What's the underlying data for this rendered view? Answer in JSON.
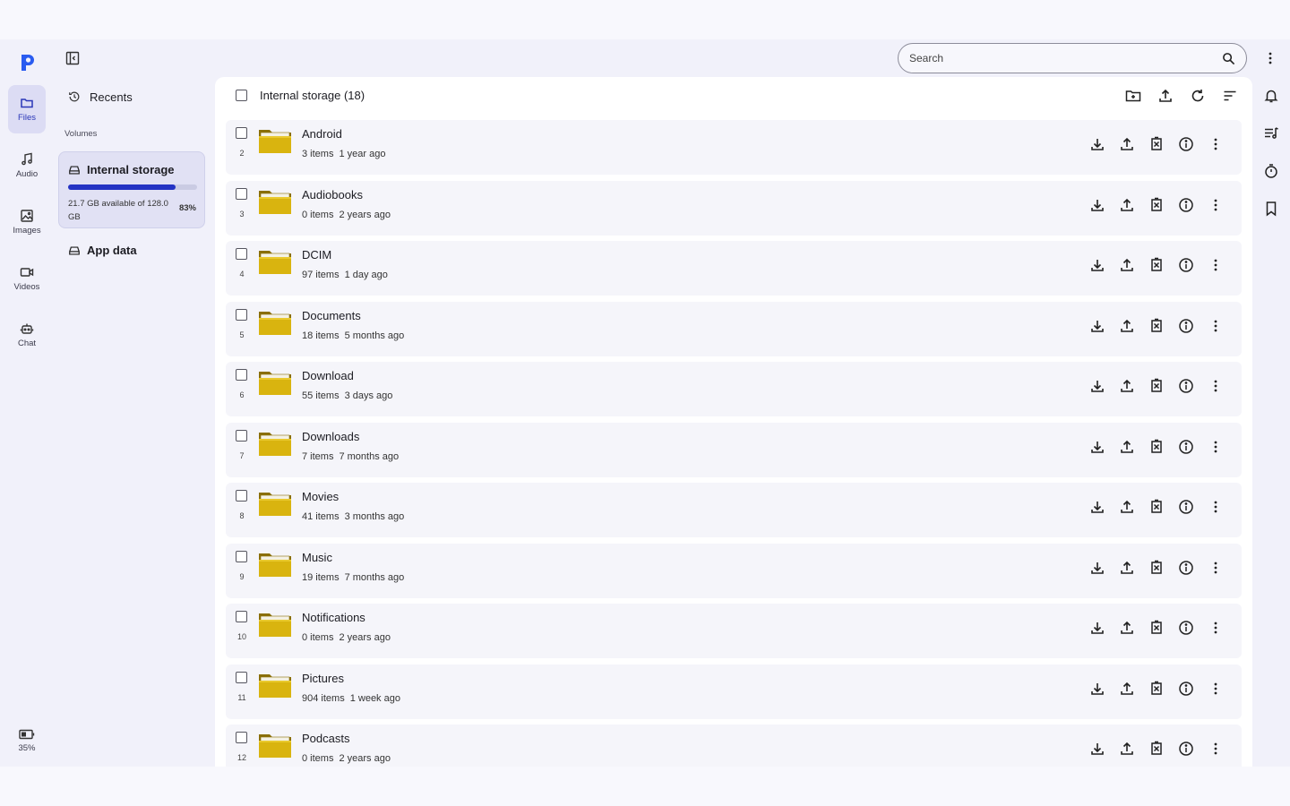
{
  "nav": {
    "items": [
      {
        "label": "Files",
        "icon": "folder-icon",
        "active": true
      },
      {
        "label": "Audio",
        "icon": "music-note-icon"
      },
      {
        "label": "Images",
        "icon": "image-icon"
      },
      {
        "label": "Videos",
        "icon": "video-camera-icon"
      },
      {
        "label": "Chat",
        "icon": "robot-icon"
      }
    ],
    "battery": "35%"
  },
  "sidebar": {
    "recents_label": "Recents",
    "volumes_label": "Volumes",
    "volume": {
      "name": "Internal storage",
      "available": "21.7 GB available of 128.0 GB",
      "percent": "83%",
      "used_fraction": 0.83
    },
    "app_data_label": "App data"
  },
  "search": {
    "placeholder": "Search"
  },
  "panel": {
    "title": "Internal storage (18)"
  },
  "folders": [
    {
      "index": "2",
      "name": "Android",
      "count": "3 items",
      "modified": "1 year ago"
    },
    {
      "index": "3",
      "name": "Audiobooks",
      "count": "0 items",
      "modified": "2 years ago"
    },
    {
      "index": "4",
      "name": "DCIM",
      "count": "97 items",
      "modified": "1 day ago"
    },
    {
      "index": "5",
      "name": "Documents",
      "count": "18 items",
      "modified": "5 months ago"
    },
    {
      "index": "6",
      "name": "Download",
      "count": "55 items",
      "modified": "3 days ago"
    },
    {
      "index": "7",
      "name": "Downloads",
      "count": "7 items",
      "modified": "7 months ago"
    },
    {
      "index": "8",
      "name": "Movies",
      "count": "41 items",
      "modified": "3 months ago"
    },
    {
      "index": "9",
      "name": "Music",
      "count": "19 items",
      "modified": "7 months ago"
    },
    {
      "index": "10",
      "name": "Notifications",
      "count": "0 items",
      "modified": "2 years ago"
    },
    {
      "index": "11",
      "name": "Pictures",
      "count": "904 items",
      "modified": "1 week ago"
    },
    {
      "index": "12",
      "name": "Podcasts",
      "count": "0 items",
      "modified": "2 years ago"
    }
  ],
  "colors": {
    "accent": "#2433c4",
    "folder": "#d9b40f"
  }
}
